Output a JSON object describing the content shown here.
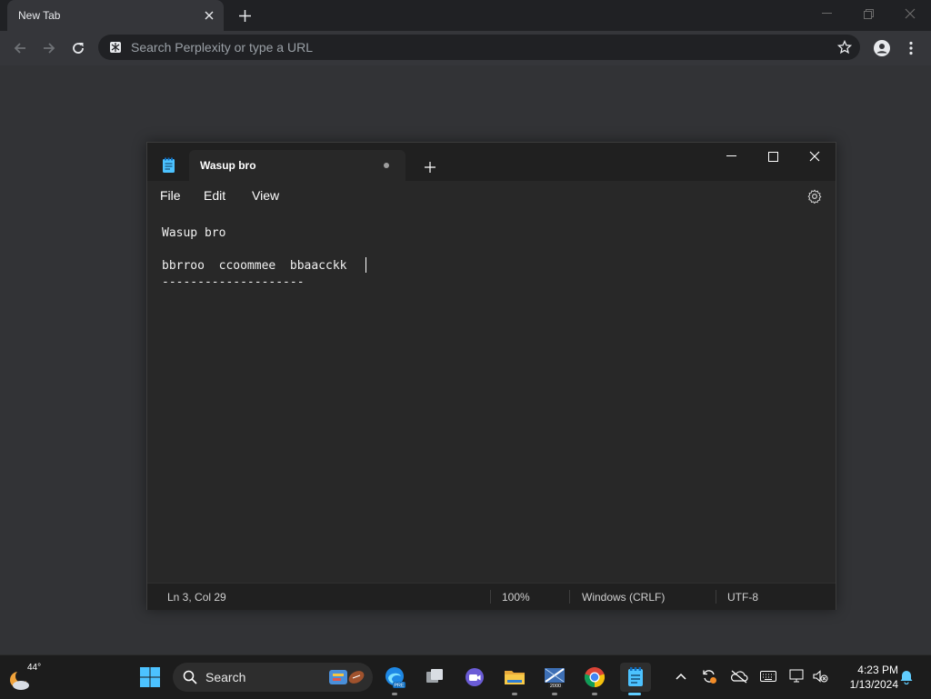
{
  "browser": {
    "tab_title": "New Tab",
    "omnibox_placeholder": "Search Perplexity or type a URL"
  },
  "notepad": {
    "tab_title": "Wasup bro",
    "menu": {
      "file": "File",
      "edit": "Edit",
      "view": "View"
    },
    "lines": [
      "Wasup bro",
      "",
      "bbrroo  ccoommee  bbaacckk  ",
      "--------------------"
    ],
    "status": {
      "position": "Ln 3, Col 29",
      "zoom": "100%",
      "line_ending": "Windows (CRLF)",
      "encoding": "UTF-8"
    }
  },
  "taskbar": {
    "weather_temp": "44°",
    "search_label": "Search",
    "apps": [
      "start-icon",
      "edge-beta-icon",
      "task-view-icon",
      "meet-icon",
      "file-explorer-icon",
      "device-manager-icon",
      "chrome-icon",
      "notepad-icon"
    ],
    "clock_time": "4:23 PM",
    "clock_date": "1/13/2024",
    "badges": {
      "edge": "PRE",
      "device": "2000"
    }
  },
  "colors": {
    "desktop": "#323336",
    "accent": "#60cdff",
    "notepad_blue": "#4cc2ff"
  }
}
